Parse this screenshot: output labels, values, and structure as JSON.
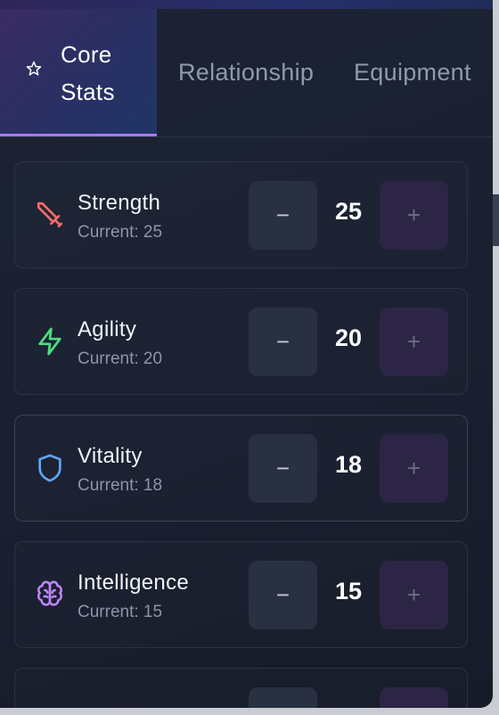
{
  "tabs": [
    {
      "label": "Core Stats",
      "icon": "star-icon",
      "active": true
    },
    {
      "label": "Relationship",
      "active": false
    },
    {
      "label": "Equipment",
      "active": false
    }
  ],
  "stats": [
    {
      "name": "Strength",
      "current_text": "Current: 25",
      "value": "25",
      "icon": "sword-icon",
      "icon_color": "#ef6b6b",
      "minus_label": "−",
      "plus_label": "+"
    },
    {
      "name": "Agility",
      "current_text": "Current: 20",
      "value": "20",
      "icon": "lightning-icon",
      "icon_color": "#4ade80",
      "minus_label": "−",
      "plus_label": "+"
    },
    {
      "name": "Vitality",
      "current_text": "Current: 18",
      "value": "18",
      "icon": "shield-icon",
      "icon_color": "#60a5fa",
      "minus_label": "−",
      "plus_label": "+"
    },
    {
      "name": "Intelligence",
      "current_text": "Current: 15",
      "value": "15",
      "icon": "brain-icon",
      "icon_color": "#c084fc",
      "minus_label": "−",
      "plus_label": "+"
    }
  ],
  "colors": {
    "accent": "#a879f2",
    "panel_bg": "#1c2333",
    "card_border": "#2b3244"
  }
}
